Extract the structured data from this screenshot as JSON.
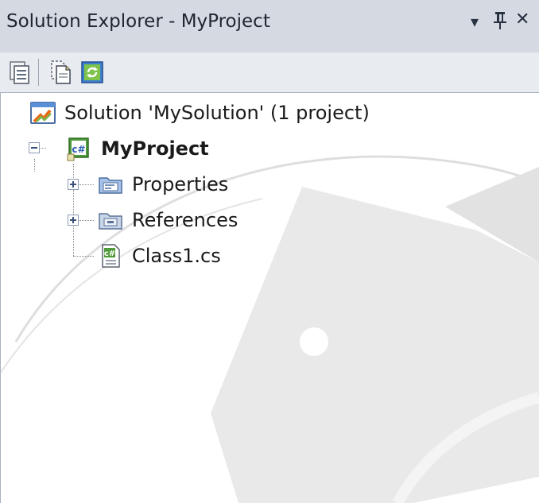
{
  "panel": {
    "title": "Solution Explorer - MyProject",
    "controls": {
      "dropdown_glyph": "▾",
      "pin_glyph": "ꟸ",
      "close_glyph": "✕"
    }
  },
  "toolbar": {
    "buttons": [
      {
        "name": "properties-button",
        "icon": "properties-icon"
      },
      {
        "name": "show-all-files-button",
        "icon": "show-all-files-icon"
      },
      {
        "name": "refresh-button",
        "icon": "refresh-icon"
      }
    ]
  },
  "tree": {
    "solution": {
      "label": "Solution 'MySolution' (1 project)",
      "icon": "solution-icon"
    },
    "project": {
      "label": "MyProject",
      "icon": "csharp-project-icon",
      "expanded": true
    },
    "children": [
      {
        "label": "Properties",
        "icon": "properties-folder-icon",
        "expandable": true,
        "expanded": false
      },
      {
        "label": "References",
        "icon": "references-folder-icon",
        "expandable": true,
        "expanded": false
      },
      {
        "label": "Class1.cs",
        "icon": "csharp-file-icon",
        "expandable": false
      }
    ]
  },
  "colors": {
    "titlebar": "#d5dae2",
    "toolbar": "#e8ebf0",
    "watermark": "#e6e6e6",
    "text": "#1a1a1a"
  }
}
